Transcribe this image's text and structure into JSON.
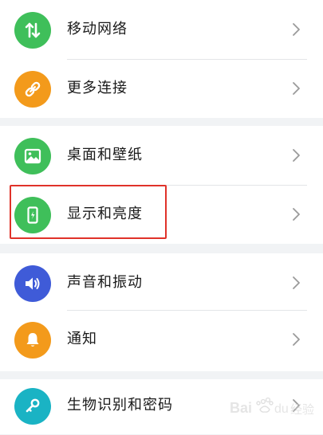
{
  "settings": {
    "items": [
      {
        "label": "移动网络",
        "icon": "mobile-network-icon",
        "color": "#3fbf5a"
      },
      {
        "label": "更多连接",
        "icon": "link-icon",
        "color": "#f39a1b"
      },
      {
        "label": "桌面和壁纸",
        "icon": "wallpaper-icon",
        "color": "#3fbf5a"
      },
      {
        "label": "显示和亮度",
        "icon": "display-brightness-icon",
        "color": "#3fbf5a"
      },
      {
        "label": "声音和振动",
        "icon": "speaker-icon",
        "color": "#3f5bd8"
      },
      {
        "label": "通知",
        "icon": "bell-icon",
        "color": "#f39a1b"
      },
      {
        "label": "生物识别和密码",
        "icon": "key-icon",
        "color": "#1ab3c4"
      }
    ]
  },
  "highlight": {
    "color": "#e0322a"
  },
  "watermark": {
    "text": "Baidu 经验"
  }
}
